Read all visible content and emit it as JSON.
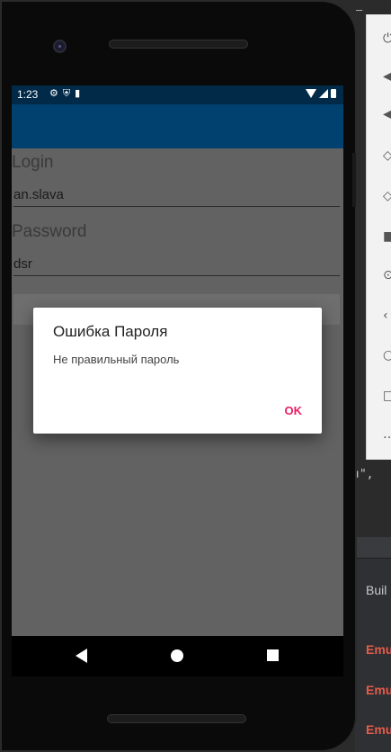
{
  "status_bar": {
    "time": "1:23",
    "icons": [
      "settings-icon",
      "shield-icon",
      "sd-card-icon",
      "wifi-icon",
      "signal-icon",
      "battery-icon"
    ]
  },
  "form": {
    "login_label": "Login",
    "login_value": "an.slava",
    "password_label": "Password",
    "password_value": "dsr"
  },
  "dialog": {
    "title": "Ошибка Пароля",
    "message": "Не правильный пароль",
    "ok_label": "OK"
  },
  "nav": {
    "icons": [
      "back-icon",
      "home-icon",
      "recents-icon"
    ]
  },
  "ide": {
    "build_label": "Buil",
    "error_items": [
      "Emu",
      "Emu",
      "Emu"
    ],
    "code_fragment": "я\","
  },
  "colors": {
    "status_bar": "#002a47",
    "app_bar": "#014170",
    "scrim": "#616161",
    "dialog_button": "#e91e63",
    "error_text": "#e45b4b"
  }
}
